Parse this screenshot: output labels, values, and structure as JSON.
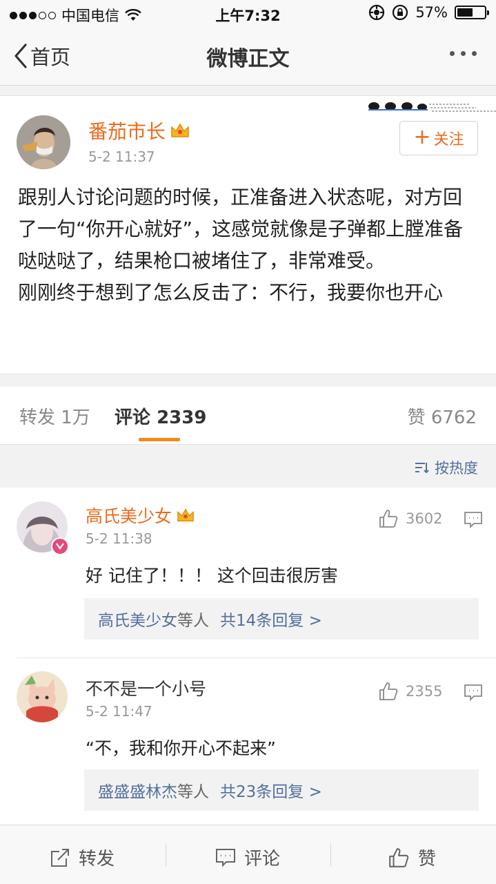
{
  "status_bar": {
    "carrier": "中国电信",
    "time": "上午7:32",
    "battery": "57%",
    "battery_level": 0.57
  },
  "nav": {
    "back_label": "首页",
    "title": "微博正文"
  },
  "post": {
    "author": "番茄市长",
    "time": "5-2 11:37",
    "follow_label": "关注",
    "paragraphs": [
      "跟别人讨论问题的时候，正准备进入状态呢，对方回了一句“你开心就好”，这感觉就像是子弹都上膛准备哒哒哒了，结果枪口被堵住了，非常难受。",
      "刚刚终于想到了怎么反击了：不行，我要你也开心"
    ]
  },
  "tabs": {
    "repost": "转发 1万",
    "comment_label": "评论",
    "comment_count": "2339",
    "likes": "赞 6762"
  },
  "sort": {
    "label": "按热度"
  },
  "comments": [
    {
      "name": "高氏美少女",
      "time": "5-2 11:38",
      "text": "好 记住了！！！ 这个回击很厉害",
      "likes": "3602",
      "reply_who": "高氏美少女",
      "reply_deng": "等人",
      "reply_count": "共14条回复 >"
    },
    {
      "name": "不不是一个小号",
      "time": "5-2 11:47",
      "text": "“不，我和你开心不起来”",
      "likes": "2355",
      "reply_who": "盛盛盛林杰",
      "reply_deng": "等人",
      "reply_count": "共23条回复 >"
    }
  ],
  "toolbar": {
    "repost": "转发",
    "comment": "评论",
    "like": "赞"
  },
  "colors": {
    "accent_orange": "#ec6b1c",
    "link_blue": "#536f9c",
    "tab_indicator": "#f28b1c"
  }
}
